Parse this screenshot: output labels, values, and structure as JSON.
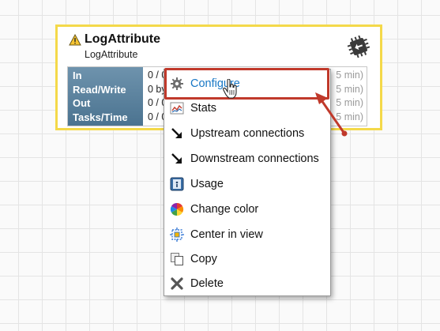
{
  "processor": {
    "name": "LogAttribute",
    "type": "LogAttribute",
    "stats": [
      {
        "label": "In",
        "value": "0 / 0",
        "window": "5 min)"
      },
      {
        "label": "Read/Write",
        "value": "0 bytes",
        "window": "5 min)"
      },
      {
        "label": "Out",
        "value": "0 / 0",
        "window": "5 min)"
      },
      {
        "label": "Tasks/Time",
        "value": "0 / 0",
        "window": "5 min)"
      }
    ],
    "border_color": "#f4d94a"
  },
  "context_menu": {
    "items": [
      {
        "label": "Configure",
        "icon": "gear-icon",
        "active": true
      },
      {
        "label": "Stats",
        "icon": "stats-chart-icon"
      },
      {
        "label": "Upstream connections",
        "icon": "arrow-down-right-icon"
      },
      {
        "label": "Downstream connections",
        "icon": "arrow-down-right-icon"
      },
      {
        "label": "Usage",
        "icon": "usage-book-icon"
      },
      {
        "label": "Change color",
        "icon": "color-wheel-icon"
      },
      {
        "label": "Center in view",
        "icon": "center-target-icon"
      },
      {
        "label": "Copy",
        "icon": "copy-icon"
      },
      {
        "label": "Delete",
        "icon": "delete-x-icon"
      }
    ]
  },
  "colors": {
    "highlight": "#c0392b",
    "active_text": "#1877c5",
    "stats_header": "#5a809c"
  }
}
